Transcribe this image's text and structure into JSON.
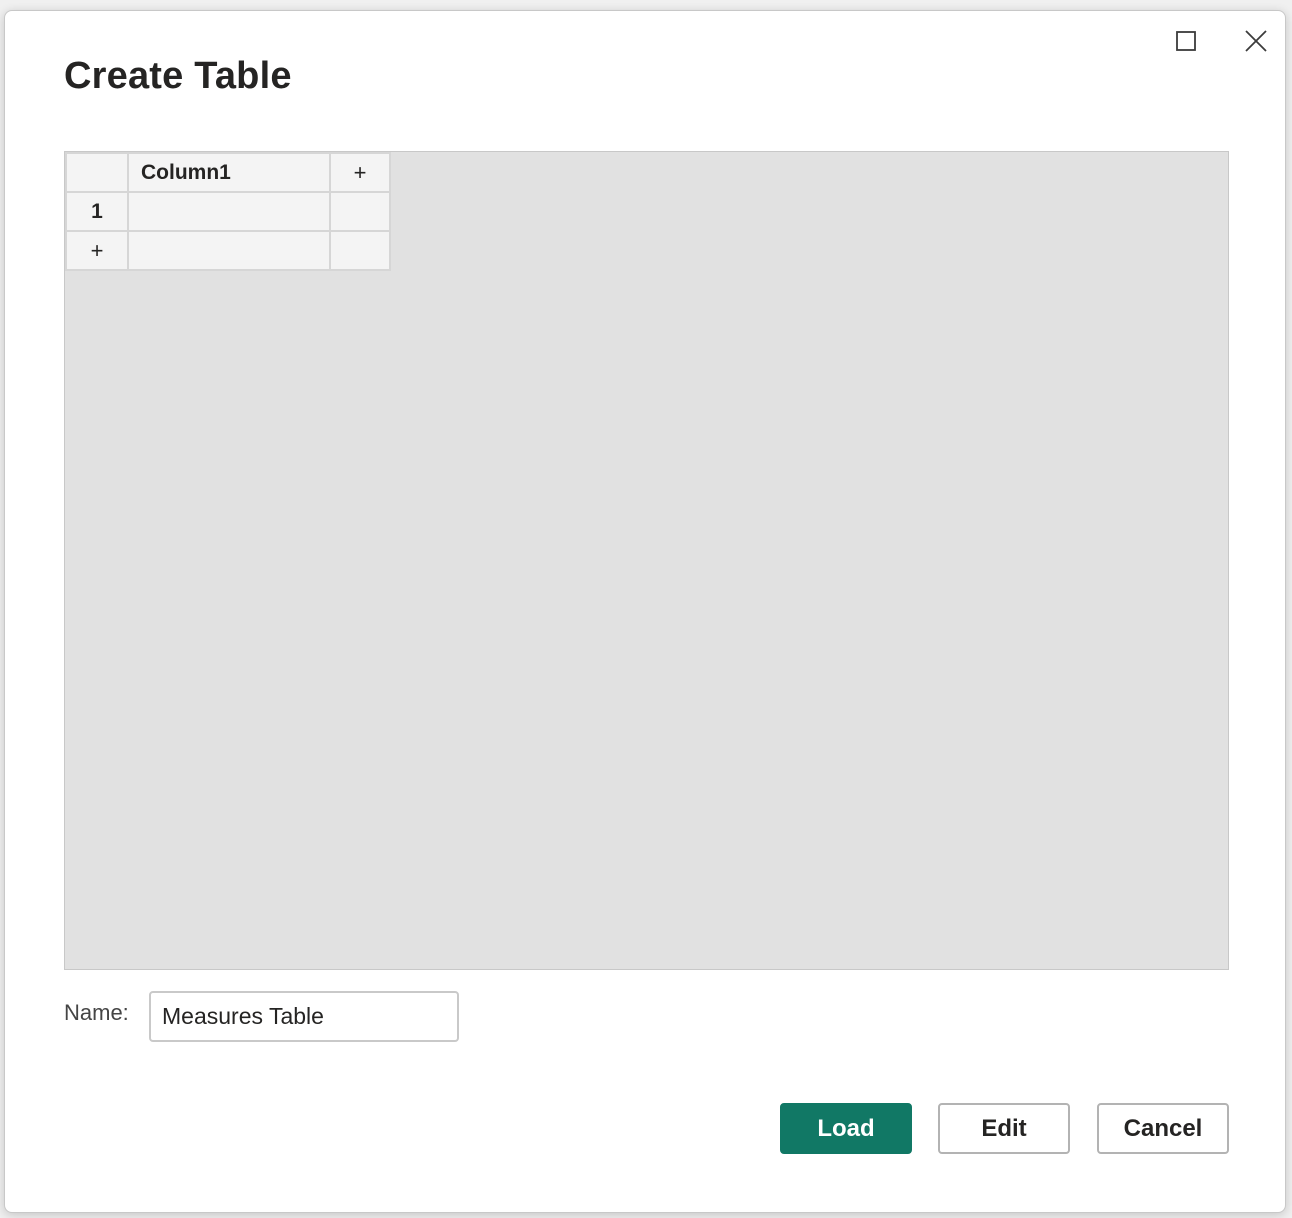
{
  "dialog": {
    "title": "Create Table",
    "controls": {
      "maximize_icon": "maximize-icon",
      "close_icon": "close-icon"
    }
  },
  "grid": {
    "columns": [
      "Column1"
    ],
    "add_column_label": "+",
    "rows": [
      {
        "number": "1",
        "cells": [
          ""
        ]
      }
    ],
    "add_row_label": "+"
  },
  "name_field": {
    "label": "Name:",
    "value": "Measures Table"
  },
  "buttons": {
    "load": "Load",
    "edit": "Edit",
    "cancel": "Cancel"
  },
  "colors": {
    "primary": "#117865",
    "grid_background": "#e1e1e1"
  }
}
